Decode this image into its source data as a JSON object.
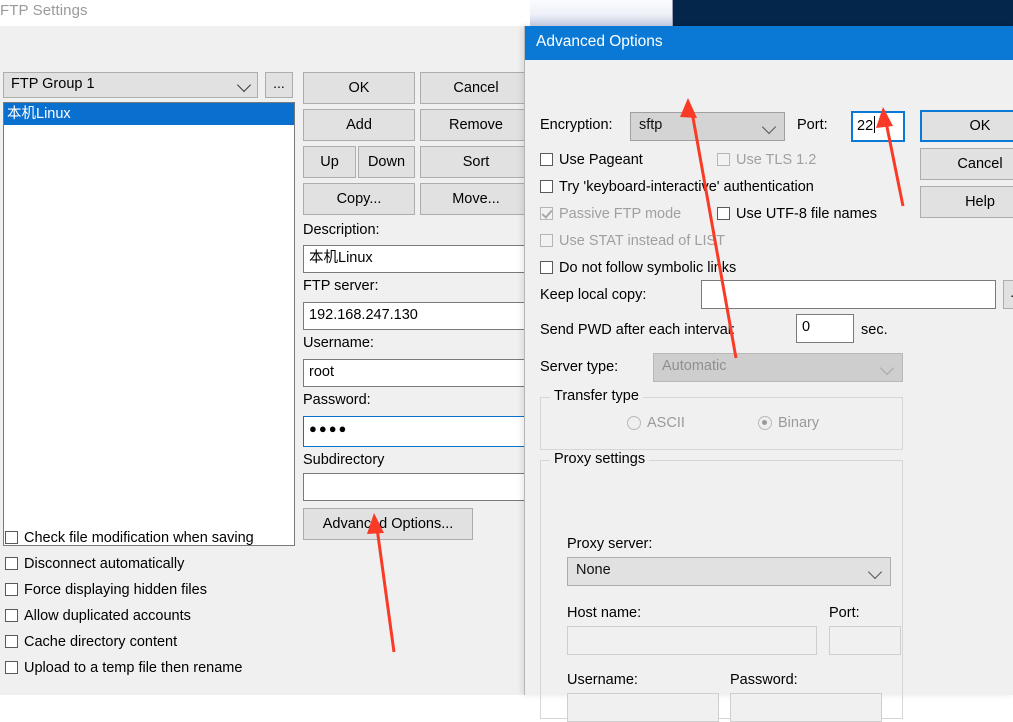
{
  "background": {
    "close_icon": "✕",
    "navy_band_color": "#05264b"
  },
  "ftp_settings": {
    "title": "FTP Settings",
    "group_combo": {
      "value": "FTP Group 1",
      "chevron_icon": "chevron-down-icon"
    },
    "group_browse_label": "...",
    "site_list": [
      {
        "label": "本机Linux",
        "selected": true
      }
    ],
    "buttons": {
      "ok": "OK",
      "cancel": "Cancel",
      "add": "Add",
      "remove": "Remove",
      "up": "Up",
      "down": "Down",
      "sort": "Sort",
      "copy": "Copy...",
      "move": "Move...",
      "advanced_options": "Advanced Options..."
    },
    "fields": {
      "description_label": "Description:",
      "description_value": "本机Linux",
      "server_label": "FTP server:",
      "server_value": "192.168.247.130",
      "username_label": "Username:",
      "username_value": "root",
      "password_label": "Password:",
      "password_value": "●●●●",
      "subdirectory_label": "Subdirectory",
      "subdirectory_value": ""
    },
    "checkboxes": [
      {
        "label": "Check file modification when saving",
        "checked": false,
        "disabled": false
      },
      {
        "label": "Disconnect automatically",
        "checked": false,
        "disabled": false
      },
      {
        "label": "Force displaying hidden files",
        "checked": false,
        "disabled": false
      },
      {
        "label": "Allow duplicated accounts",
        "checked": false,
        "disabled": false
      },
      {
        "label": "Cache directory content",
        "checked": false,
        "disabled": false
      },
      {
        "label": "Upload to a temp file then rename",
        "checked": false,
        "disabled": false
      }
    ]
  },
  "advanced_options": {
    "title": "Advanced Options",
    "titlebar_color": "#0a79d6",
    "encryption_label": "Encryption:",
    "encryption_value": "sftp",
    "port_label": "Port:",
    "port_value": "22",
    "buttons": {
      "ok": "OK",
      "cancel": "Cancel",
      "help": "Help"
    },
    "checkboxes": [
      {
        "label": "Use Pageant",
        "checked": false,
        "disabled": false
      },
      {
        "label": "Use TLS 1.2",
        "checked": false,
        "disabled": true
      },
      {
        "label": "Try 'keyboard-interactive' authentication",
        "checked": false,
        "disabled": false
      },
      {
        "label": "Passive FTP mode",
        "checked": true,
        "disabled": true
      },
      {
        "label": "Use UTF-8 file names",
        "checked": false,
        "disabled": false
      },
      {
        "label": "Use STAT instead of LIST",
        "checked": false,
        "disabled": true
      },
      {
        "label": "Do not follow symbolic links",
        "checked": false,
        "disabled": false
      }
    ],
    "keep_local_copy_label": "Keep local copy:",
    "keep_local_copy_value": "",
    "keep_local_browse_label": "...",
    "send_pwd_label": "Send PWD after each interval:",
    "send_pwd_value": "0",
    "send_pwd_unit": "sec.",
    "server_type_label": "Server type:",
    "server_type_value": "Automatic",
    "transfer_type": {
      "group_title": "Transfer type",
      "options": [
        {
          "label": "ASCII",
          "selected": false
        },
        {
          "label": "Binary",
          "selected": true
        }
      ]
    },
    "proxy_settings": {
      "group_title": "Proxy settings",
      "server_label": "Proxy server:",
      "server_value": "None",
      "host_label": "Host name:",
      "host_value": "",
      "port_label": "Port:",
      "port_value": "",
      "username_label": "Username:",
      "username_value": "",
      "password_label": "Password:",
      "password_value": ""
    }
  },
  "annotations": {
    "color": "#f93a26",
    "arrows": [
      {
        "target": "encryption-combo"
      },
      {
        "target": "port-input"
      },
      {
        "target": "advanced-options-button"
      }
    ]
  }
}
